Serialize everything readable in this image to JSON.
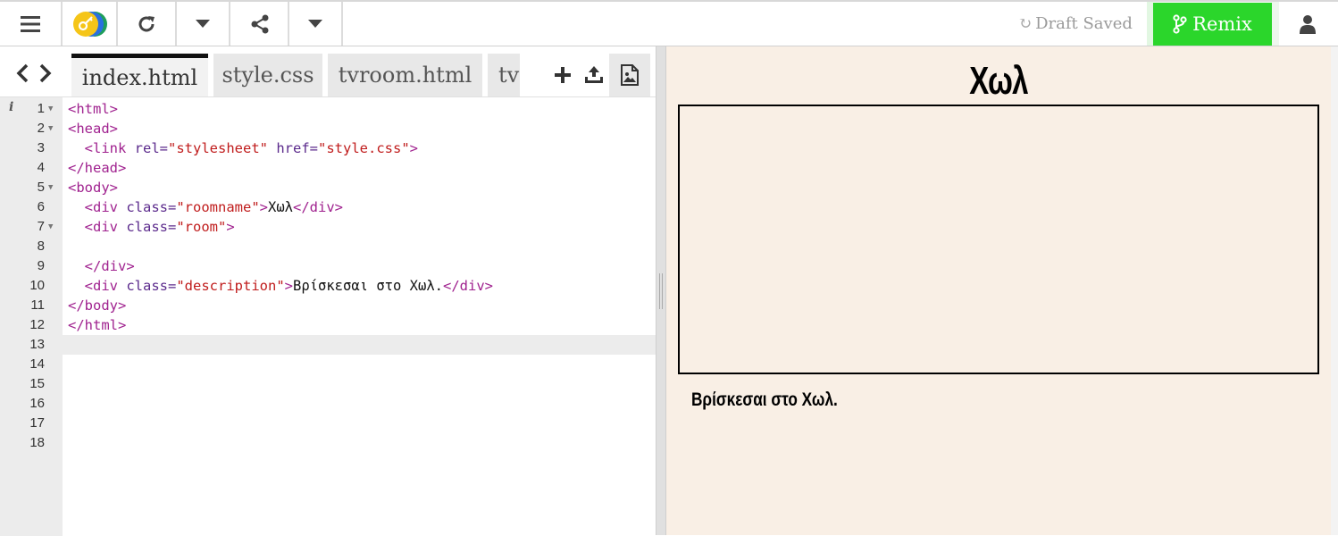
{
  "toolbar": {
    "draft_status": "Draft Saved",
    "remix_label": "Remix"
  },
  "editor": {
    "tabs": [
      {
        "label": "index.html",
        "active": true
      },
      {
        "label": "style.css",
        "active": false
      },
      {
        "label": "tvroom.html",
        "active": false
      },
      {
        "label": "tv",
        "active": false
      }
    ],
    "lines": [
      {
        "num": "1",
        "fold": true
      },
      {
        "num": "2",
        "fold": true
      },
      {
        "num": "3",
        "fold": false
      },
      {
        "num": "4",
        "fold": false
      },
      {
        "num": "5",
        "fold": true
      },
      {
        "num": "6",
        "fold": false
      },
      {
        "num": "7",
        "fold": true
      },
      {
        "num": "8",
        "fold": false
      },
      {
        "num": "9",
        "fold": false
      },
      {
        "num": "10",
        "fold": false
      },
      {
        "num": "11",
        "fold": false
      },
      {
        "num": "12",
        "fold": false
      },
      {
        "num": "13",
        "fold": false
      },
      {
        "num": "14",
        "fold": false
      },
      {
        "num": "15",
        "fold": false
      },
      {
        "num": "16",
        "fold": false
      },
      {
        "num": "17",
        "fold": false
      },
      {
        "num": "18",
        "fold": false
      }
    ],
    "code": {
      "l1": "<html>",
      "l2": "<head>",
      "l3_open": "<link ",
      "l3_rel": "rel=",
      "l3_rel_val": "\"stylesheet\"",
      "l3_href": "href=",
      "l3_href_val": "\"style.css\"",
      "l3_close": ">",
      "l4": "</head>",
      "l5": "<body>",
      "l6_open": "<div ",
      "l6_attr": "class=",
      "l6_val": "\"roomname\"",
      "l6_gt": ">",
      "l6_text": "Χωλ",
      "l6_close": "</div>",
      "l7_open": "<div ",
      "l7_attr": "class=",
      "l7_val": "\"room\"",
      "l7_gt": ">",
      "l9": "</div>",
      "l10_open": "<div ",
      "l10_attr": "class=",
      "l10_val": "\"description\"",
      "l10_gt": ">",
      "l10_text": "Βρίσκεσαι στο Χωλ.",
      "l10_close": "</div>",
      "l11": "</body>",
      "l12": "</html>"
    },
    "current_line": "13"
  },
  "preview": {
    "room_name": "Χωλ",
    "description": "Βρίσκεσαι στο Χωλ."
  },
  "colors": {
    "remix_green": "#2bd62b",
    "preview_bg": "#f9efe5",
    "tag": "#a0228f",
    "string": "#c01c1c"
  }
}
